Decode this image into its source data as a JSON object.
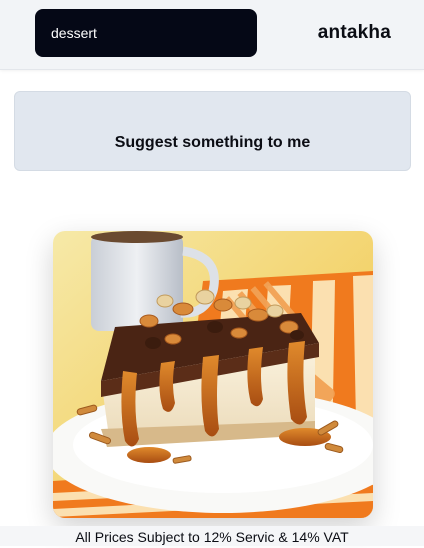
{
  "header": {
    "search_value": "dessert",
    "brand": "antakha"
  },
  "main": {
    "suggest_label": "Suggest something to me",
    "featured_item": {
      "image_icon": "dessert-photo"
    }
  },
  "footer": {
    "notice": "All Prices Subject to 12% Servic & 14% VAT"
  },
  "colors": {
    "header_bg": "#f2f4f7",
    "search_bg": "#050816",
    "button_bg": "#e1e7ef",
    "caramel": "#c8641a",
    "chocolate": "#4a2414"
  }
}
